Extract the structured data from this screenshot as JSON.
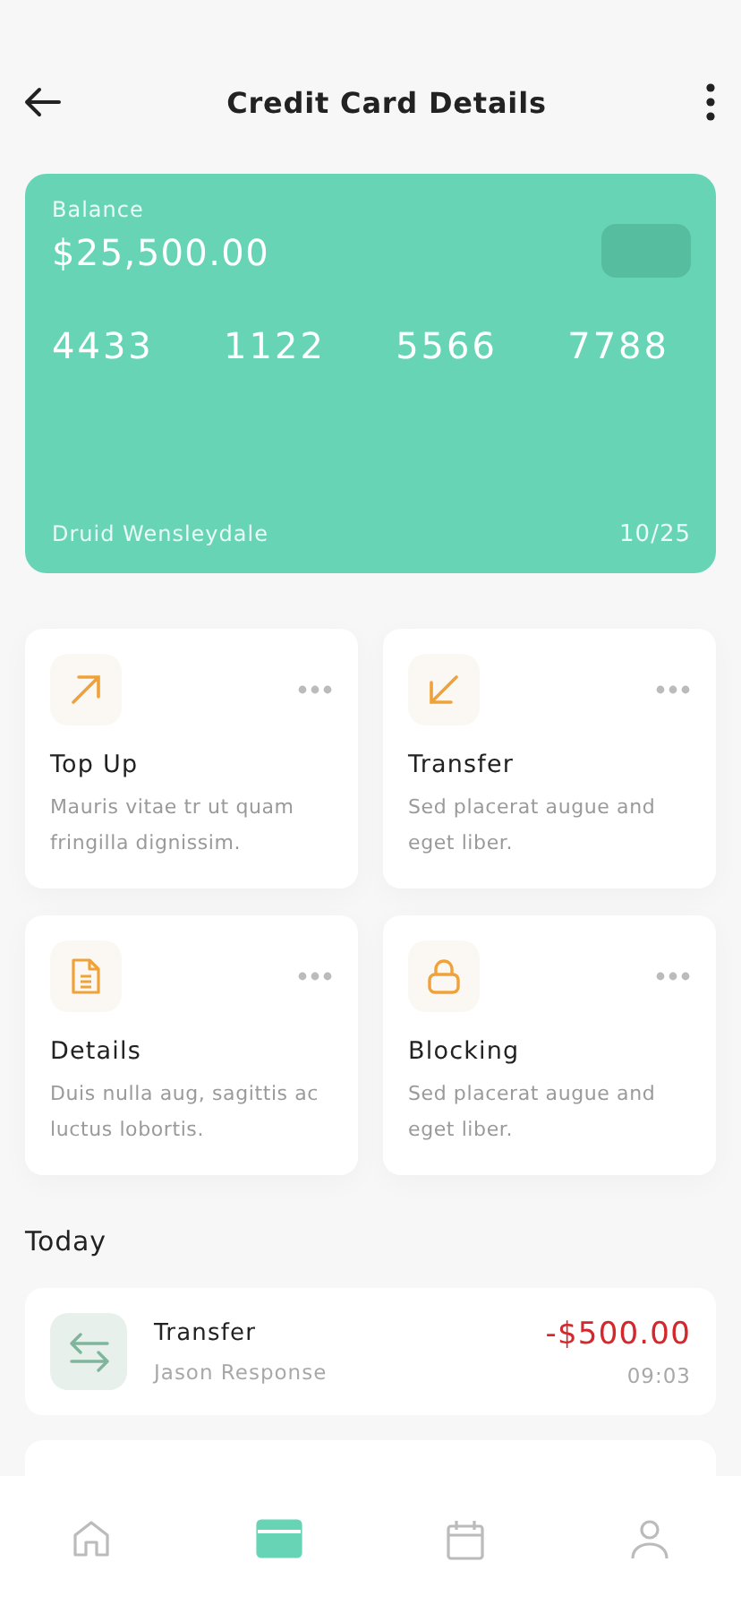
{
  "header": {
    "title": "Credit Card Details"
  },
  "card": {
    "balance_label": "Balance",
    "balance": "$25,500.00",
    "number_groups": [
      "4433",
      "1122",
      "5566",
      "7788"
    ],
    "holder": "Druid Wensleydale",
    "expiry": "10/25"
  },
  "actions": [
    {
      "kind": "topup",
      "title": "Top Up",
      "description": "Mauris vitae tr ut quam fringilla dignissim."
    },
    {
      "kind": "transfer",
      "title": "Transfer",
      "description": "Sed placerat augue and eget liber."
    },
    {
      "kind": "details",
      "title": "Details",
      "description": "Duis nulla aug, sagittis ac luctus lobortis."
    },
    {
      "kind": "blocking",
      "title": "Blocking",
      "description": "Sed placerat augue and eget liber."
    }
  ],
  "section_title": "Today",
  "transactions": [
    {
      "kind": "transfer",
      "title": "Transfer",
      "subtitle": "Jason Response",
      "amount": "-$500.00",
      "time": "09:03"
    }
  ],
  "nav": [
    {
      "kind": "home",
      "selected": false
    },
    {
      "kind": "card",
      "selected": true
    },
    {
      "kind": "calendar",
      "selected": false
    },
    {
      "kind": "profile",
      "selected": false
    }
  ]
}
